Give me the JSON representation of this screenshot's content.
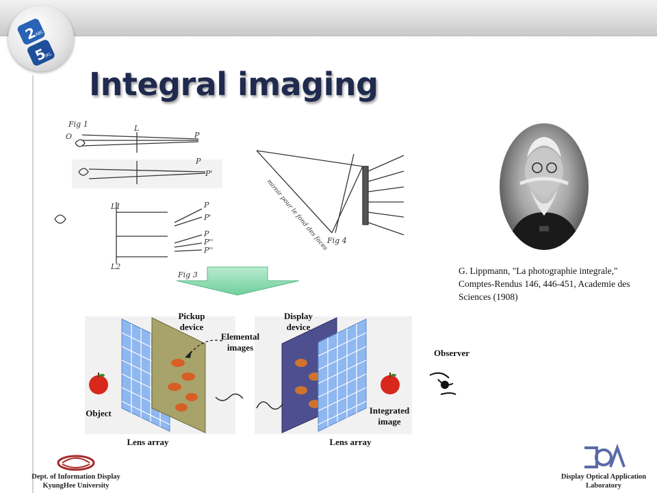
{
  "slide": {
    "title": "Integral imaging",
    "citation": "G. Lippmann, \"La photographie integrale,\" Comptes-Rendus 146, 446-451, Academie des Sciences (1908)"
  },
  "logo": {
    "text_top": "2",
    "text_small": "ABC",
    "text_bottom": "5",
    "text_small2": "JKL"
  },
  "sketch": {
    "fig1": "Fig 1",
    "fig3": "Fig 3",
    "fig4": "Fig 4",
    "o": "O",
    "l": "L",
    "p": "P",
    "p_prime": "P'",
    "l1": "L1",
    "l2": "L2",
    "p_dprime": "P''",
    "mirror_note": "miroir pour le fond des faces"
  },
  "diagram": {
    "pickup_device": "Pickup device",
    "elemental_images": "Elemental images",
    "display_device": "Display device",
    "observer": "Observer",
    "object": "Object",
    "lens_array_left": "Lens array",
    "lens_array_right": "Lens array",
    "integrated_image": "Integrated image"
  },
  "footer": {
    "left_line1": "Dept. of Information Display",
    "left_line2": "KyungHee University",
    "right_line1": "Display Optical Application",
    "right_line2": "Laboratory"
  },
  "colors": {
    "title": "#1f2a4e",
    "arrow": "#7fd6a6",
    "lens_array": "#8fb7f0",
    "pickup_panel": "#a7a36a",
    "display_panel": "#4e4f8f",
    "apple": "#d8281c"
  }
}
